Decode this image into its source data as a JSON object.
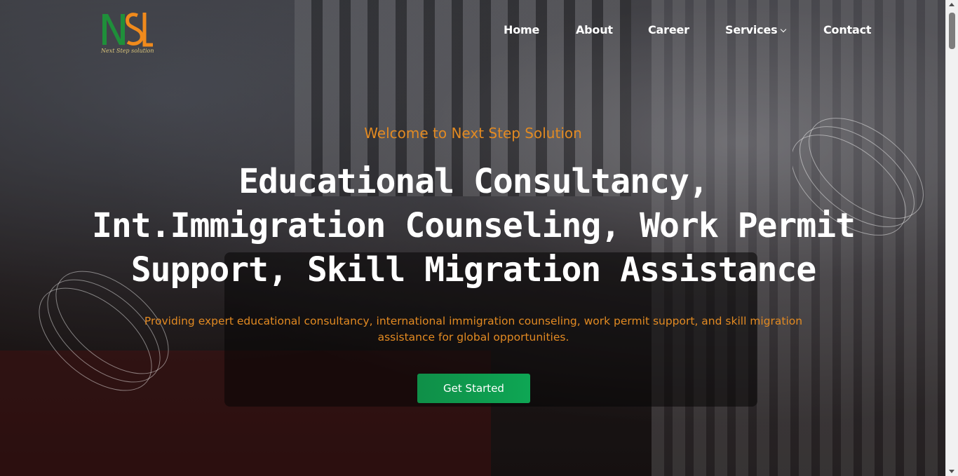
{
  "brand": {
    "logo_mark": "NSL",
    "logo_tagline": "Next Step solution",
    "colors": {
      "green": "#1f8f3a",
      "orange": "#f08a1c",
      "accent": "#e28a22",
      "cta": "#0ea654"
    }
  },
  "nav": {
    "items": [
      {
        "label": "Home"
      },
      {
        "label": "About"
      },
      {
        "label": "Career"
      },
      {
        "label": "Services",
        "icon": "chevron-down-icon"
      },
      {
        "label": "Contact"
      }
    ]
  },
  "hero": {
    "eyebrow": "Welcome to Next Step Solution",
    "headline": "Educational Consultancy, Int.Immigration Counseling, Work Permit Support, Skill Migration Assistance",
    "subtext": "Providing expert educational consultancy, international immigration counseling, work permit support, and skill migration assistance for global opportunities.",
    "cta_label": "Get Started"
  }
}
